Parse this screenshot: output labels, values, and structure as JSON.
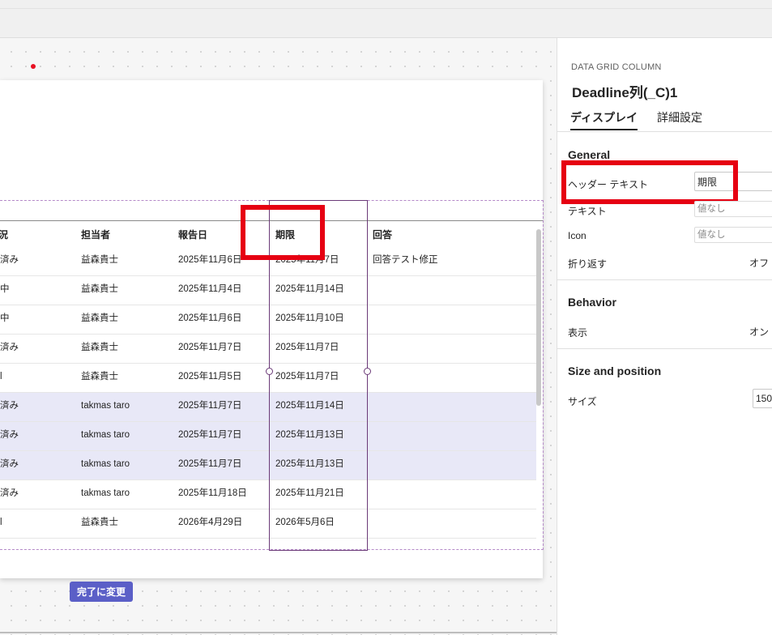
{
  "canvas": {
    "columns": [
      "況",
      "担当者",
      "報告日",
      "期限",
      "回答"
    ],
    "rows": [
      {
        "status": "済み",
        "assignee": "益森貴士",
        "report_date": "2025年11月6日",
        "deadline": "2025年11月7日",
        "answer": "回答テスト修正",
        "selected": false
      },
      {
        "status": "中",
        "assignee": "益森貴士",
        "report_date": "2025年11月4日",
        "deadline": "2025年11月14日",
        "answer": "",
        "selected": false
      },
      {
        "status": "中",
        "assignee": "益森貴士",
        "report_date": "2025年11月6日",
        "deadline": "2025年11月10日",
        "answer": "",
        "selected": false
      },
      {
        "status": "済み",
        "assignee": "益森貴士",
        "report_date": "2025年11月7日",
        "deadline": "2025年11月7日",
        "answer": "",
        "selected": false
      },
      {
        "status": "l",
        "assignee": "益森貴士",
        "report_date": "2025年11月5日",
        "deadline": "2025年11月7日",
        "answer": "",
        "selected": false
      },
      {
        "status": "済み",
        "assignee": "takmas taro",
        "report_date": "2025年11月7日",
        "deadline": "2025年11月14日",
        "answer": "",
        "selected": true
      },
      {
        "status": "済み",
        "assignee": "takmas taro",
        "report_date": "2025年11月7日",
        "deadline": "2025年11月13日",
        "answer": "",
        "selected": true
      },
      {
        "status": "済み",
        "assignee": "takmas taro",
        "report_date": "2025年11月7日",
        "deadline": "2025年11月13日",
        "answer": "",
        "selected": true
      },
      {
        "status": "済み",
        "assignee": "takmas taro",
        "report_date": "2025年11月18日",
        "deadline": "2025年11月21日",
        "answer": "",
        "selected": false
      },
      {
        "status": "l",
        "assignee": "益森貴士",
        "report_date": "2026年4月29日",
        "deadline": "2026年5月6日",
        "answer": "",
        "selected": false
      }
    ],
    "complete_button": "完了に変更"
  },
  "panel": {
    "kicker": "DATA GRID COLUMN",
    "title": "Deadline列(_C)1",
    "tabs": [
      "ディスプレイ",
      "詳細設定"
    ],
    "general": {
      "title": "General",
      "header_text_label": "ヘッダー テキスト",
      "header_text_value": "期限",
      "text_label": "テキスト",
      "text_placeholder": "値なし",
      "icon_label": "Icon",
      "icon_placeholder": "値なし",
      "wrap_label": "折り返す",
      "wrap_value": "オフ"
    },
    "behavior": {
      "title": "Behavior",
      "visible_label": "表示",
      "visible_value": "オン"
    },
    "size_position": {
      "title": "Size and position",
      "size_label": "サイズ",
      "size_value": "150"
    }
  },
  "colors": {
    "accent": "#5b5fc7",
    "selection_border": "#6b3a78",
    "highlight_red": "#e60012",
    "selected_row": "#e8e8f7"
  }
}
